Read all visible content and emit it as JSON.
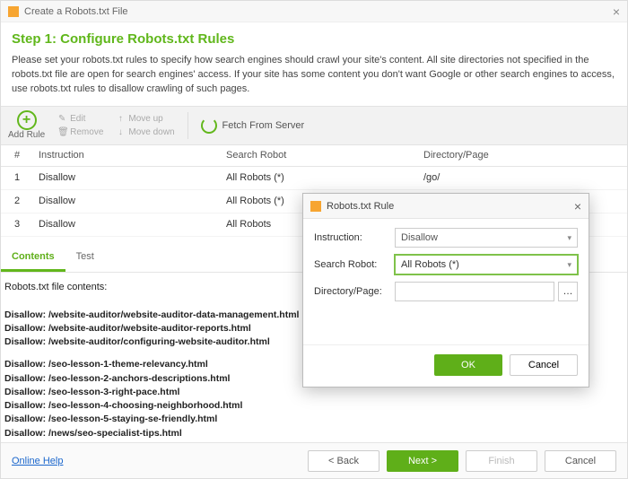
{
  "window": {
    "title": "Create a Robots.txt File"
  },
  "header": {
    "step_title": "Step 1: Configure Robots.txt Rules",
    "description": "Please set your robots.txt rules to specify how search engines should crawl your site's content. All site directories not specified in the robots.txt file are open for search engines' access. If your site has some content you don't want Google or other search engines to access, use robots.txt rules to disallow crawling of such pages."
  },
  "toolbar": {
    "add_rule": "Add Rule",
    "edit": "Edit",
    "remove": "Remove",
    "move_up": "Move up",
    "move_down": "Move down",
    "fetch": "Fetch From Server"
  },
  "table": {
    "headers": {
      "num": "#",
      "instruction": "Instruction",
      "robot": "Search Robot",
      "dir": "Directory/Page"
    },
    "rows": [
      {
        "n": "1",
        "instruction": "Disallow",
        "robot": "All Robots (*)",
        "dir": "/go/"
      },
      {
        "n": "2",
        "instruction": "Disallow",
        "robot": "All Robots (*)",
        "dir": ""
      },
      {
        "n": "3",
        "instruction": "Disallow",
        "robot": "All Robots",
        "dir": ""
      }
    ]
  },
  "tabs": {
    "contents": "Contents",
    "test": "Test"
  },
  "file": {
    "heading": "Robots.txt file contents:",
    "lines_a": [
      "Disallow: /website-auditor/website-auditor-data-management.html",
      "Disallow: /website-auditor/website-auditor-reports.html",
      "Disallow: /website-auditor/configuring-website-auditor.html"
    ],
    "lines_b": [
      "Disallow: /seo-lesson-1-theme-relevancy.html",
      "Disallow: /seo-lesson-2-anchors-descriptions.html",
      "Disallow: /seo-lesson-3-right-pace.html",
      "Disallow: /seo-lesson-4-choosing-neighborhood.html",
      "Disallow: /seo-lesson-5-staying-se-friendly.html",
      "Disallow: /news/seo-specialist-tips.html"
    ]
  },
  "footer": {
    "online_help": "Online Help",
    "back": "< Back",
    "next": "Next >",
    "finish": "Finish",
    "cancel": "Cancel"
  },
  "dialog": {
    "title": "Robots.txt Rule",
    "labels": {
      "instruction": "Instruction:",
      "robot": "Search Robot:",
      "dir": "Directory/Page:"
    },
    "values": {
      "instruction": "Disallow",
      "robot": "All Robots (*)",
      "dir": ""
    },
    "ok": "OK",
    "cancel": "Cancel"
  }
}
